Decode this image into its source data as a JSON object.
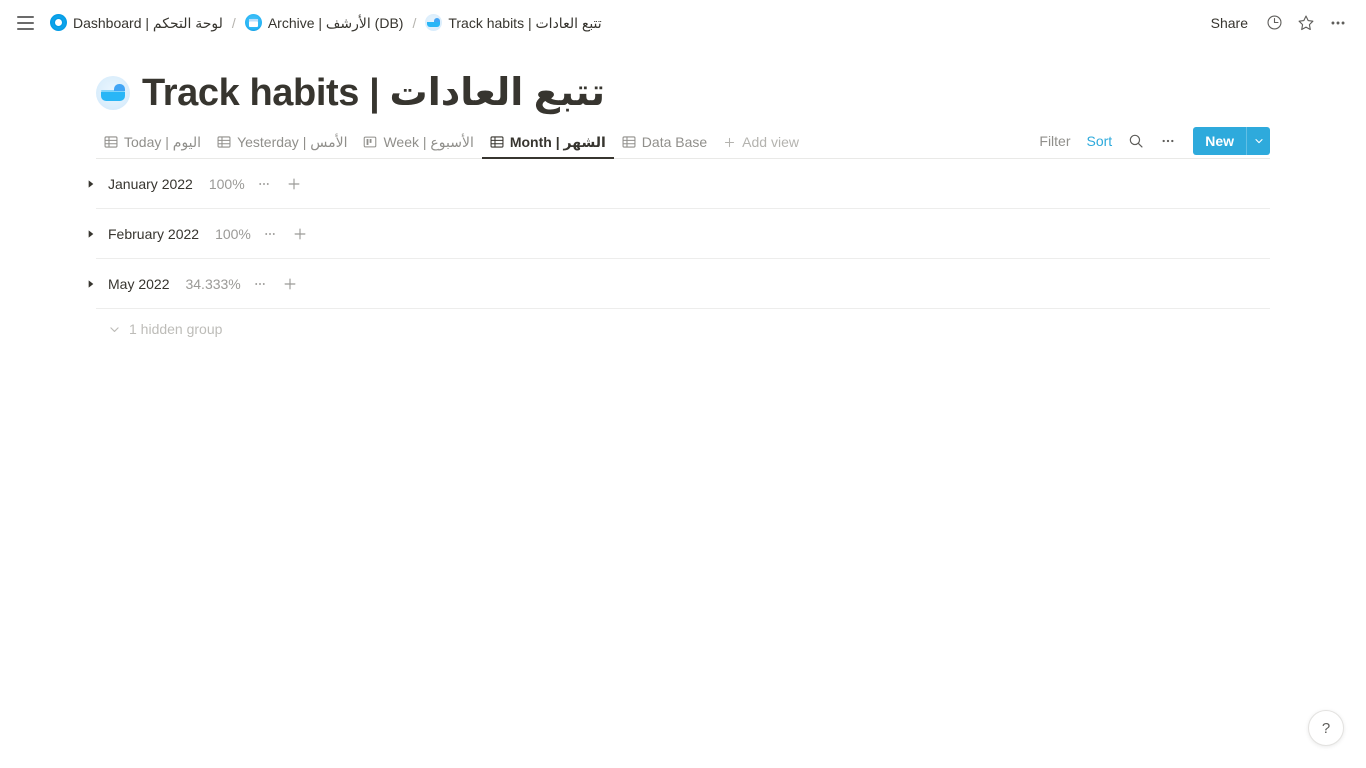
{
  "topbar": {
    "menu_icon": "hamburger-icon",
    "breadcrumb": [
      {
        "icon": "dashboard-badge-icon",
        "label": "Dashboard | لوحة التحكم"
      },
      {
        "icon": "archive-box-icon",
        "label": "Archive | الأرشف (DB)"
      },
      {
        "icon": "bathtub-icon",
        "label": "Track habits | تتبع العادات"
      }
    ],
    "separator": "/",
    "share_label": "Share",
    "history_icon": "clock-icon",
    "favorite_icon": "star-icon",
    "more_icon": "ellipsis-icon"
  },
  "page": {
    "emoji": "bathtub-icon",
    "title": "Track habits | تتبع العادات"
  },
  "views": {
    "tabs": [
      {
        "label": "Today | اليوم",
        "icon": "table-view-icon",
        "active": false
      },
      {
        "label": "Yesterday | الأمس",
        "icon": "table-view-icon",
        "active": false
      },
      {
        "label": "Week | الأسبوع",
        "icon": "board-view-icon",
        "active": false
      },
      {
        "label": "Month | الشهر",
        "icon": "table-view-icon",
        "active": true
      },
      {
        "label": "Data Base",
        "icon": "table-view-icon",
        "active": false
      }
    ],
    "add_view_label": "Add view",
    "add_view_icon": "plus-icon",
    "filter_label": "Filter",
    "sort_label": "Sort",
    "search_icon": "search-icon",
    "more_icon": "ellipsis-icon",
    "new_label": "New",
    "new_caret_icon": "chevron-down-icon",
    "accent_color": "#2eaadc"
  },
  "groups": [
    {
      "toggle_icon": "triangle-right-icon",
      "name": "January 2022",
      "percent": "100%",
      "more_icon": "ellipsis-icon",
      "add_icon": "plus-icon"
    },
    {
      "toggle_icon": "triangle-right-icon",
      "name": "February 2022",
      "percent": "100%",
      "more_icon": "ellipsis-icon",
      "add_icon": "plus-icon"
    },
    {
      "toggle_icon": "triangle-right-icon",
      "name": "May 2022",
      "percent": "34.333%",
      "more_icon": "ellipsis-icon",
      "add_icon": "plus-icon"
    }
  ],
  "hidden_group": {
    "icon": "chevron-down-icon",
    "label": "1 hidden group"
  },
  "help": {
    "label": "?"
  }
}
